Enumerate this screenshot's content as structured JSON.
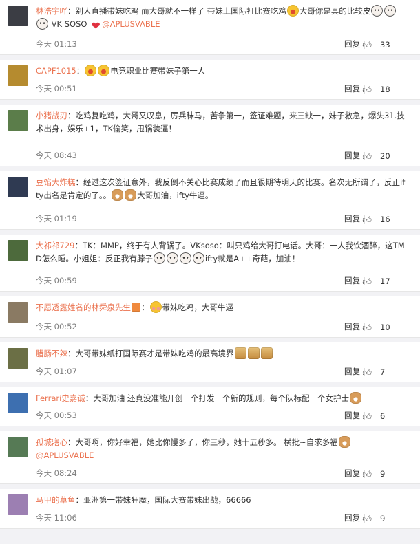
{
  "ui": {
    "reply_label": "回复",
    "like_icon": "thumbs-up-icon"
  },
  "comments": [
    {
      "avatar_color": "#3b3d44",
      "name": "林浩宇吖",
      "segments": [
        {
          "t": "text",
          "v": "：别人直播带妹吃鸡 而大哥就不一样了 带妹上国际打比赛吃鸡"
        },
        {
          "t": "emoji",
          "kind": "laugh"
        },
        {
          "t": "text",
          "v": "大哥你是真的比较皮"
        },
        {
          "t": "emoji",
          "kind": "face"
        },
        {
          "t": "emoji",
          "kind": "face"
        },
        {
          "t": "emoji",
          "kind": "face"
        },
        {
          "t": "text",
          "v": " VK SOSO "
        },
        {
          "t": "emoji",
          "kind": "heart"
        },
        {
          "t": "link",
          "v": "@APLUSVABLE"
        }
      ],
      "time": "今天 01:13",
      "likes": "33",
      "height": 80
    },
    {
      "avatar_color": "#b58b2f",
      "name": "CAPF1015",
      "segments": [
        {
          "t": "text",
          "v": "："
        },
        {
          "t": "emoji",
          "kind": "laugh"
        },
        {
          "t": "emoji",
          "kind": "laugh"
        },
        {
          "t": "text",
          "v": "电竞职业比赛带妹子第一人"
        }
      ],
      "time": "今天 00:51",
      "likes": "18",
      "height": 58
    },
    {
      "avatar_color": "#5b7d4a",
      "name": "小猪战刃",
      "segments": [
        {
          "t": "text",
          "v": "：吃鸡复吃鸡，大哥又叹息，厉兵秣马，苦争第一，签证难题，来三缺一，妹子救急，爆头31.技术出身，娱乐+1，TK偷笑，甩锅装逼！"
        }
      ],
      "time": "今天 08:43",
      "likes": "20",
      "height": 90
    },
    {
      "avatar_color": "#2f3a52",
      "name": "豆馅大炸糕",
      "segments": [
        {
          "t": "text",
          "v": "：经过这次签证意外，我反倒不关心比赛成绩了而且很期待明天的比赛。名次无所谓了，反正ifty出名是肯定的了。。"
        },
        {
          "t": "emoji",
          "kind": "dog"
        },
        {
          "t": "emoji",
          "kind": "dog"
        },
        {
          "t": "text",
          "v": "大哥加油，ifty牛逼。"
        }
      ],
      "time": "今天 01:19",
      "likes": "16",
      "height": 85
    },
    {
      "avatar_color": "#4d6a3c",
      "name": "大祁祁729",
      "segments": [
        {
          "t": "text",
          "v": "：TK：MMP，终于有人背锅了。VKsoso：叫只鸡给大哥打电话。大哥：一人我饮酒醉，这TMD怎么睡。小姐姐：反正我有脖子"
        },
        {
          "t": "emoji",
          "kind": "face"
        },
        {
          "t": "emoji",
          "kind": "face"
        },
        {
          "t": "emoji",
          "kind": "face"
        },
        {
          "t": "emoji",
          "kind": "face"
        },
        {
          "t": "text",
          "v": "ifty就是A++奇葩，加油！"
        }
      ],
      "time": "今天 00:59",
      "likes": "17",
      "height": 83
    },
    {
      "avatar_color": "#8a7a63",
      "name": "不愿透露姓名的林舜泉先生",
      "segments": [
        {
          "t": "emoji",
          "kind": "gift"
        },
        {
          "t": "text",
          "v": "："
        },
        {
          "t": "emoji",
          "kind": "blush"
        },
        {
          "t": "text",
          "v": "带妹吃鸡，大哥牛逼"
        }
      ],
      "time": "今天 00:52",
      "likes": "10",
      "height": 60
    },
    {
      "avatar_color": "#6b6f45",
      "name": "腊肠不辣",
      "segments": [
        {
          "t": "text",
          "v": "：大哥带妹纸打国际赛才是带妹吃鸡的最高境界"
        },
        {
          "t": "emoji",
          "kind": "doge"
        },
        {
          "t": "emoji",
          "kind": "doge"
        },
        {
          "t": "emoji",
          "kind": "doge"
        }
      ],
      "time": "今天 01:07",
      "likes": "7",
      "height": 58
    },
    {
      "avatar_color": "#3d6fb0",
      "name": "Ferrari史嘉诚",
      "segments": [
        {
          "t": "text",
          "v": "：大哥加油 还真没准能开创一个打发一个新的规则，每个队标配一个女护士"
        },
        {
          "t": "emoji",
          "kind": "dog"
        }
      ],
      "time": "今天 00:53",
      "likes": "6",
      "height": 57
    },
    {
      "avatar_color": "#567a55",
      "name": "孤城寤心",
      "segments": [
        {
          "t": "text",
          "v": "：大哥啊，你好幸福，她比你慢多了，你三秒，她十五秒多。 横批~自求多福"
        },
        {
          "t": "emoji",
          "kind": "dog"
        },
        {
          "t": "br"
        },
        {
          "t": "link",
          "v": "@APLUSVABLE"
        }
      ],
      "time": "今天 08:24",
      "likes": "9",
      "height": 77
    },
    {
      "avatar_color": "#9c7fb2",
      "name": "马甲的草鱼",
      "segments": [
        {
          "t": "text",
          "v": "：亚洲第一带妹狂魔，国际大赛带妹出战，66666"
        }
      ],
      "time": "今天 11:06",
      "likes": "9",
      "height": 58
    }
  ]
}
